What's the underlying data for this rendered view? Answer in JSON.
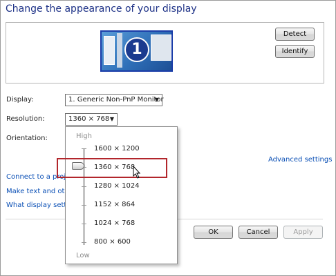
{
  "title": "Change the appearance of your display",
  "preview": {
    "monitor_number": "1",
    "detect_label": "Detect",
    "identify_label": "Identify"
  },
  "display": {
    "label": "Display:",
    "value": "1. Generic Non-PnP Monitor"
  },
  "resolution": {
    "label": "Resolution:",
    "value": "1360 × 768",
    "dropdown": {
      "high_label": "High",
      "low_label": "Low",
      "options": [
        "1600 × 1200",
        "1360 × 768",
        "1280 × 1024",
        "1152 × 864",
        "1024 × 768",
        "800 × 600"
      ],
      "selected_index": 1
    }
  },
  "orientation": {
    "label": "Orientation:"
  },
  "links": {
    "advanced": "Advanced settings",
    "connect": "Connect to a proje",
    "text_size": "Make text and other",
    "what_settings": "What display setting"
  },
  "buttons": {
    "ok": "OK",
    "cancel": "Cancel",
    "apply": "Apply"
  },
  "colors": {
    "title": "#1e3287",
    "link": "#0a4fb5",
    "highlight": "#b2262c"
  }
}
